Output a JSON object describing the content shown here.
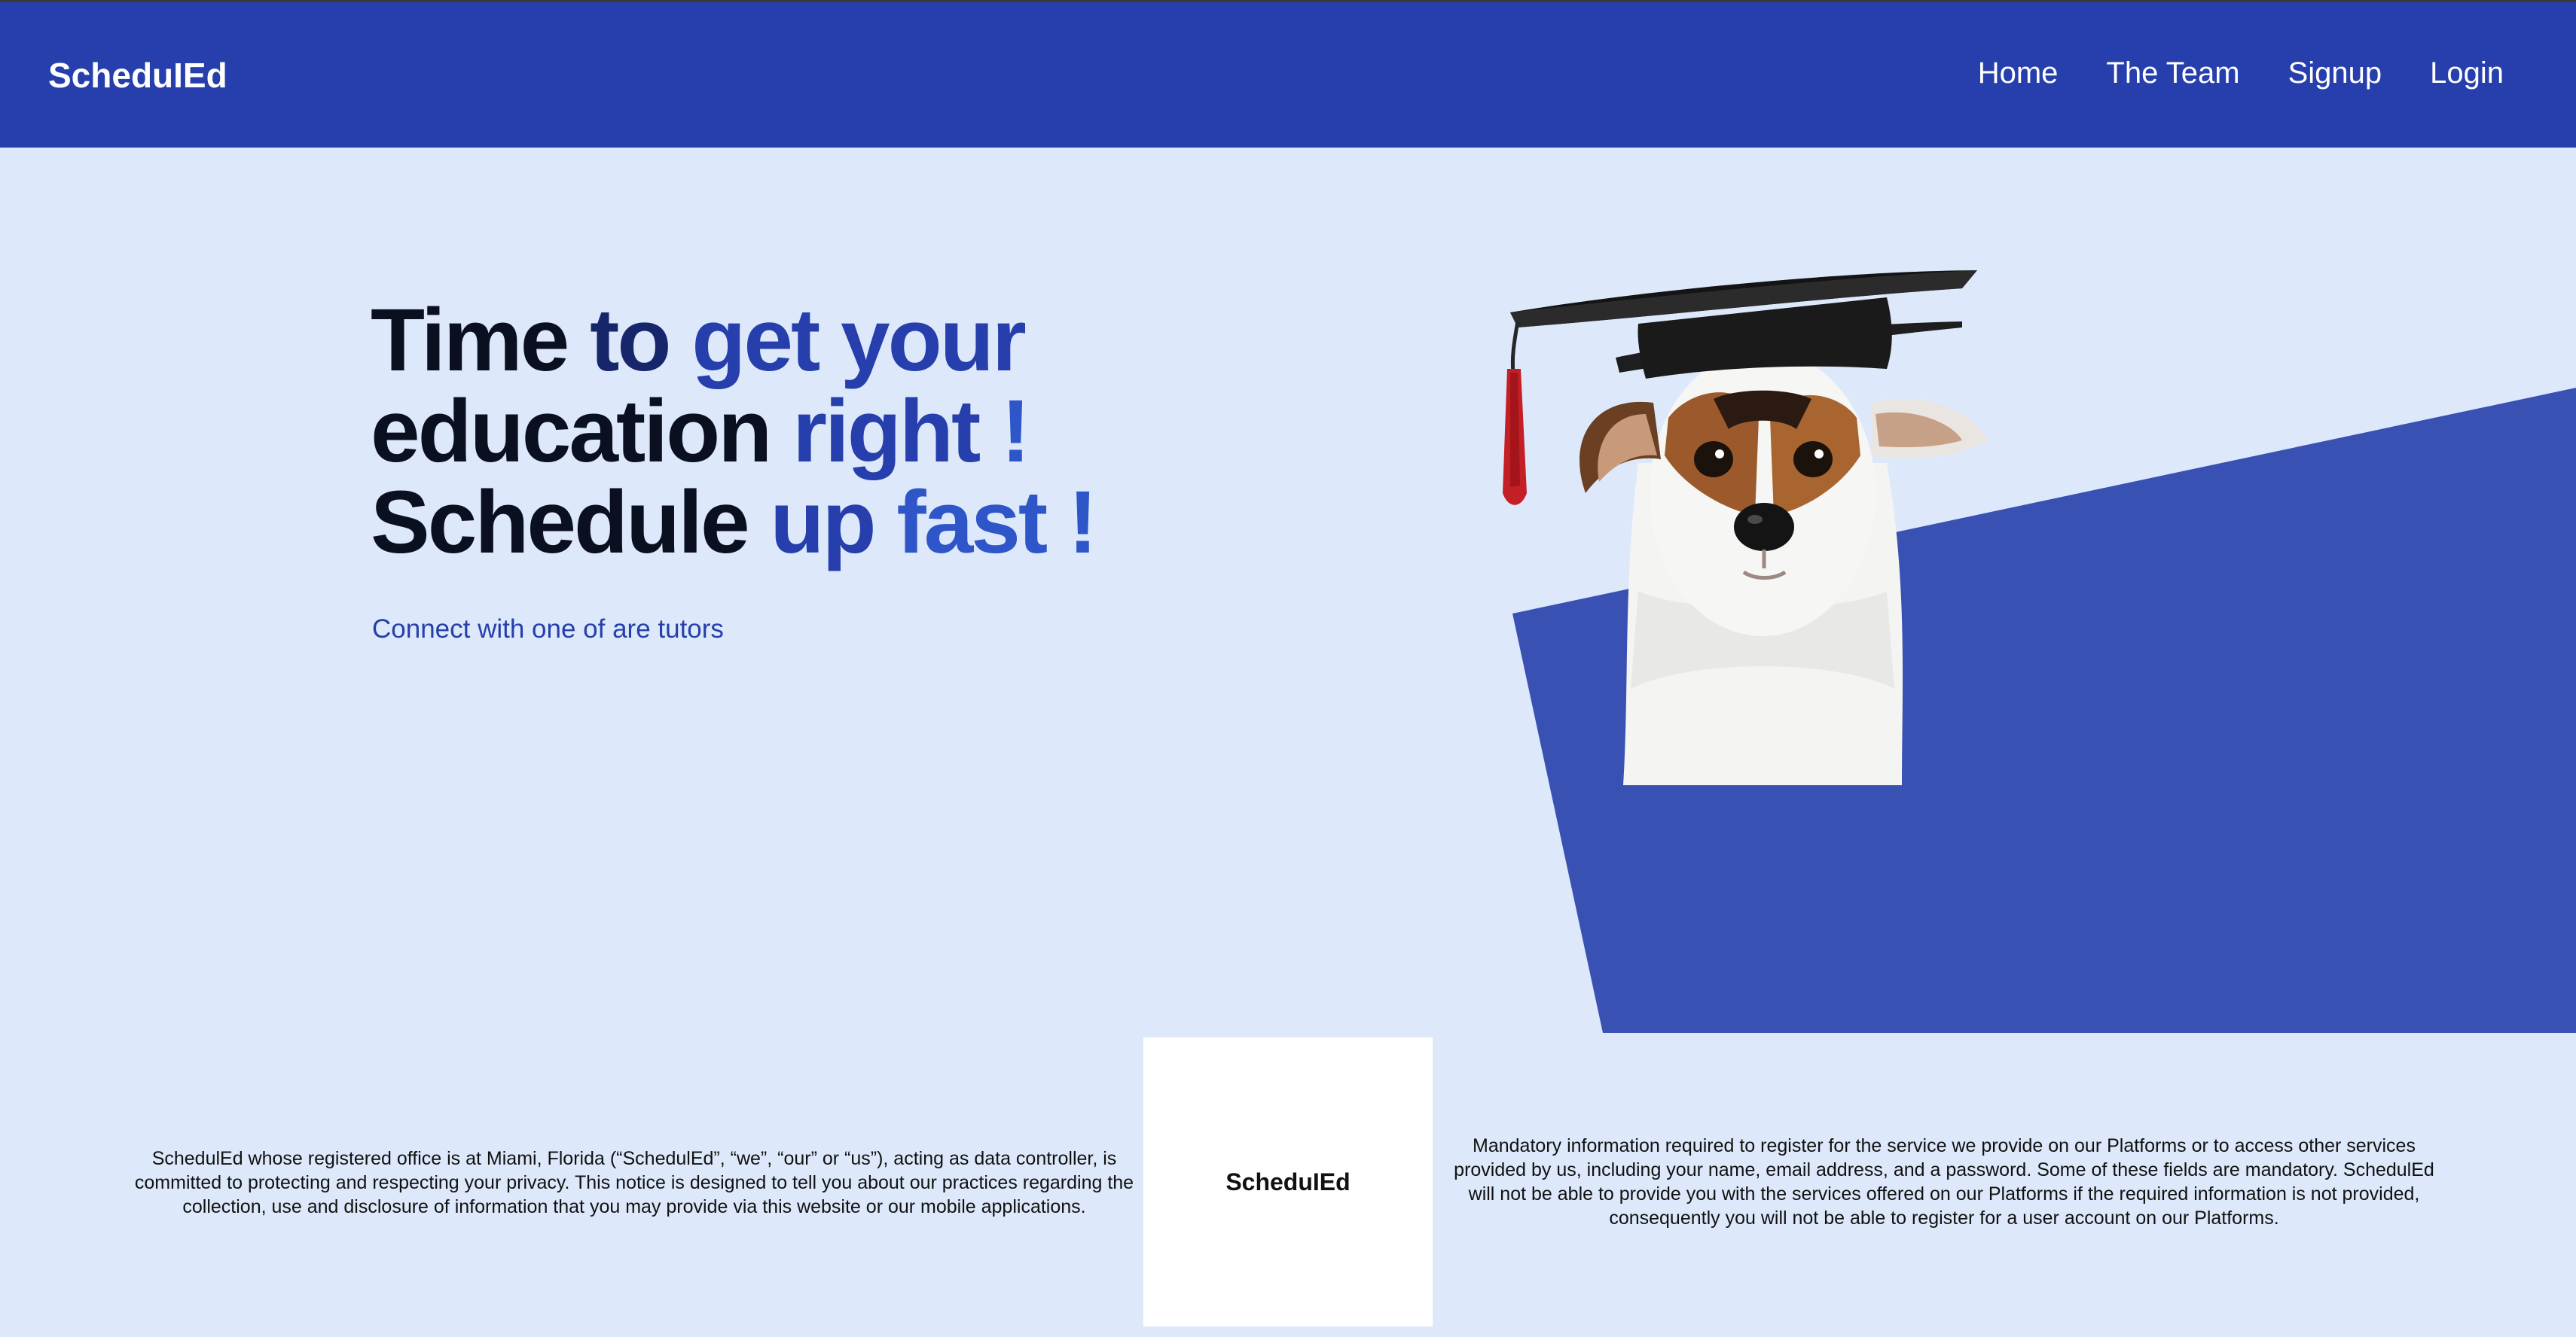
{
  "nav": {
    "brand": "ScheduIEd",
    "links": [
      {
        "label": "Home"
      },
      {
        "label": "The Team"
      },
      {
        "label": "Signup"
      },
      {
        "label": "Login"
      }
    ]
  },
  "hero": {
    "headline_lines": [
      [
        "Time",
        "to",
        "get",
        "your"
      ],
      [
        "education",
        "right",
        "!"
      ],
      [
        "Schedule",
        "up",
        "fast",
        "!"
      ]
    ],
    "subtitle": "Connect with one of are tutors",
    "image_alt": "dog wearing graduation cap"
  },
  "footer": {
    "left_text": "SchedulEd whose registered office is at Miami, Florida (“SchedulEd”, “we”, “our” or “us”), acting as data controller, is committed to protecting and respecting your privacy. This notice is designed to tell you about our practices regarding the collection, use and disclosure of information that you may provide via this website or our mobile applications.",
    "logo_text": "ScheduIEd",
    "right_text": "Mandatory information required to register for the service we provide on our Platforms or to access other services provided by us, including your name, email address, and a password. Some of these fields are mandatory. SchedulEd will not be able to provide you with the services offered on our Platforms if the required information is not provided, consequently you will not be able to register for a user account on our Platforms."
  },
  "colors": {
    "navbar": "#263fac",
    "page_background": "#dde9fb",
    "accent_shape": "#3a51b4",
    "dark_text": "#0b1020",
    "link_blue": "#263fac"
  }
}
